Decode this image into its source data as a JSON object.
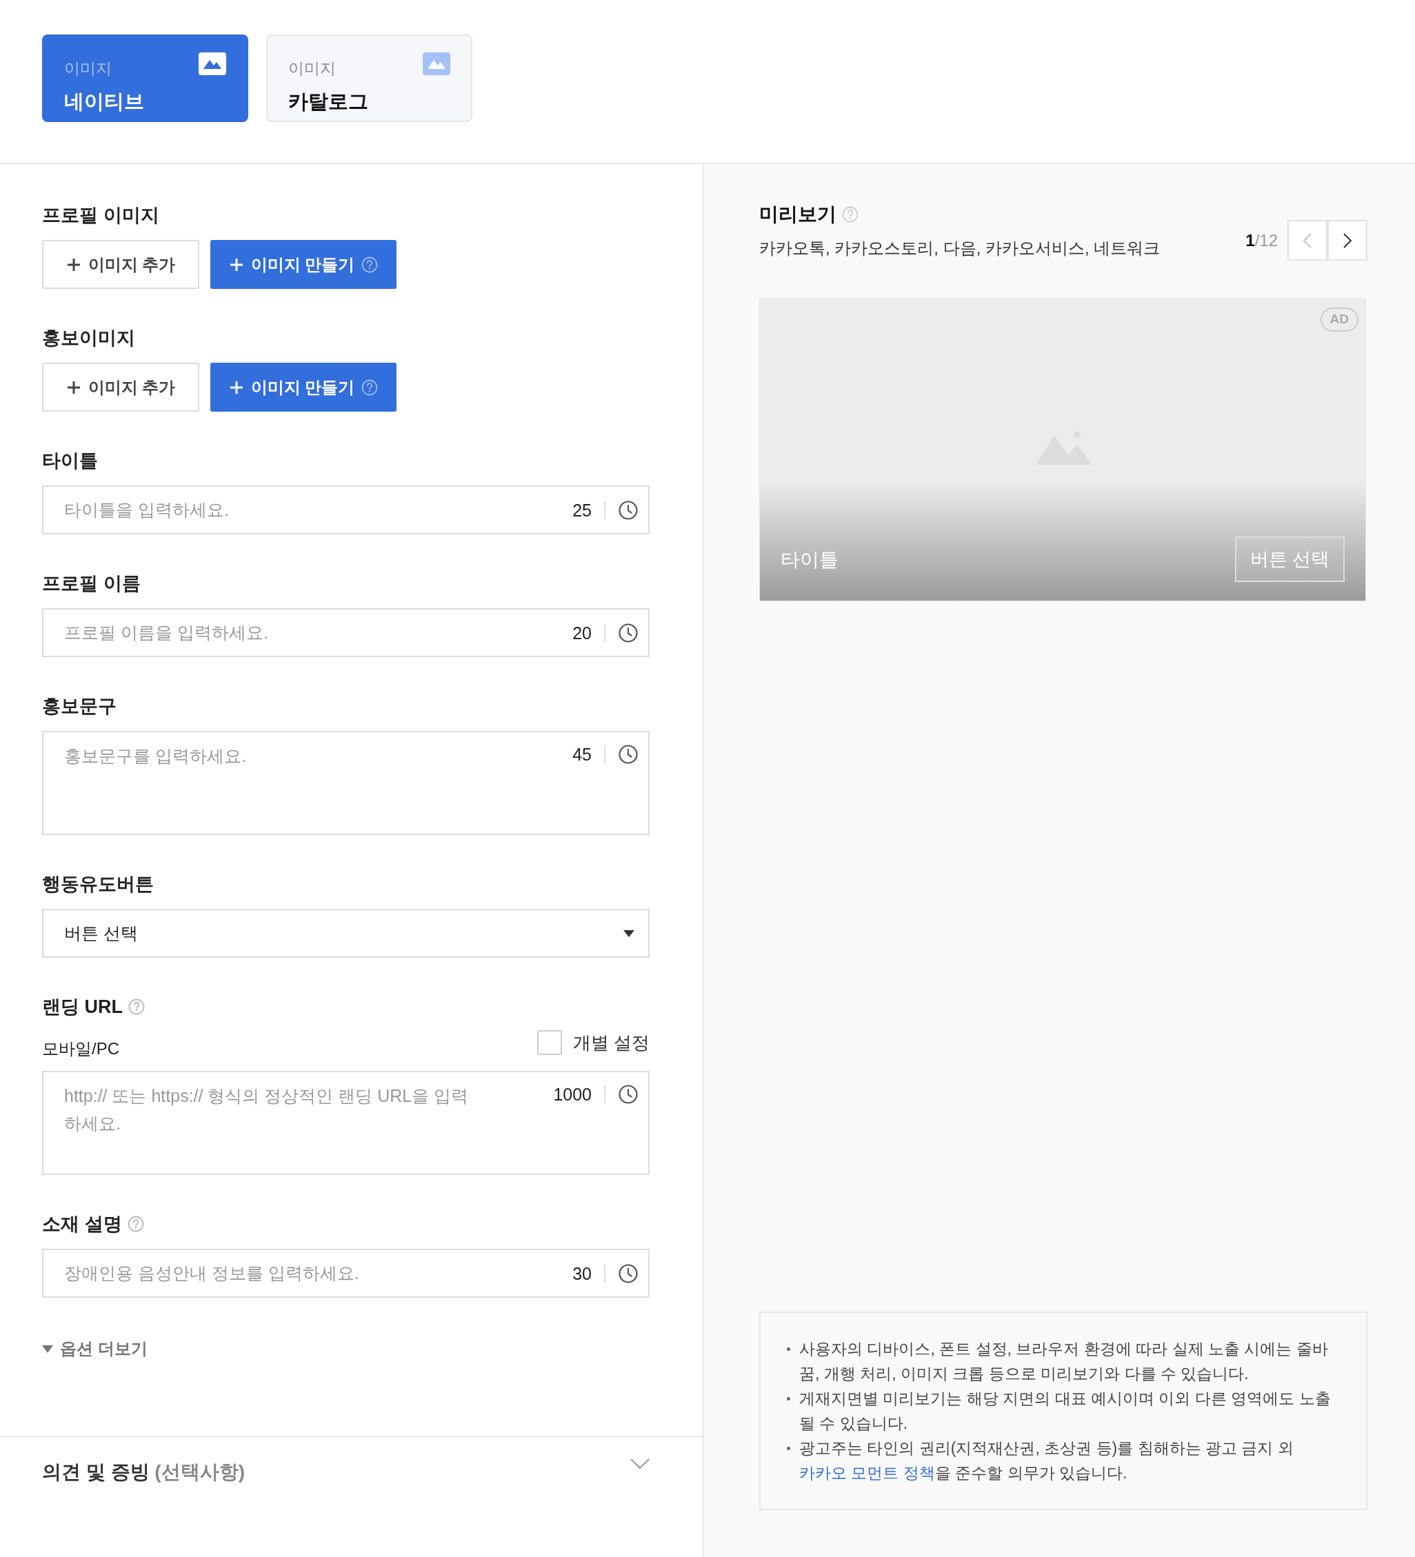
{
  "tabs": [
    {
      "caption": "이미지",
      "label": "네이티브",
      "selected": true
    },
    {
      "caption": "이미지",
      "label": "카탈로그",
      "selected": false
    }
  ],
  "image_sections": [
    {
      "label": "프로필 이미지",
      "buttons": [
        {
          "kind": "outline",
          "label": "이미지 추가",
          "help": false
        },
        {
          "kind": "primary",
          "label": "이미지 만들기",
          "help": true
        }
      ]
    },
    {
      "label": "홍보이미지",
      "buttons": [
        {
          "kind": "outline",
          "label": "이미지 추가",
          "help": false
        },
        {
          "kind": "primary",
          "label": "이미지 만들기",
          "help": true
        }
      ]
    }
  ],
  "fields": [
    {
      "kind": "input",
      "label": "타이틀",
      "help": false,
      "placeholder": "타이틀을 입력하세요.",
      "counter": "25"
    },
    {
      "kind": "input",
      "label": "프로필 이름",
      "help": false,
      "placeholder": "프로필 이름을 입력하세요.",
      "counter": "20"
    },
    {
      "kind": "textarea",
      "label": "홍보문구",
      "help": false,
      "placeholder": "홍보문구를 입력하세요.",
      "counter": "45"
    },
    {
      "kind": "select",
      "label": "행동유도버튼",
      "help": false,
      "value": "버튼 선택"
    },
    {
      "kind": "url",
      "label": "랜딩 URL",
      "help": true,
      "sublabel": "모바일/PC",
      "checkbox": {
        "label": "개별 설정",
        "checked": false
      },
      "placeholder": "http:// 또는 https:// 형식의 정상적인 랜딩 URL을 입력하세요.",
      "counter": "1000"
    },
    {
      "kind": "input",
      "label": "소재 설명",
      "help": true,
      "placeholder": "장애인용 음성안내 정보를 입력하세요.",
      "counter": "30"
    }
  ],
  "more_options": {
    "label": "옵션 더보기",
    "expanded": false
  },
  "opinion_section": {
    "title": "의견 및 증빙",
    "optional": "(선택사항)",
    "expanded": false
  },
  "preview": {
    "title": "미리보기",
    "placements": "카카오톡, 카카오스토리, 다음, 카카오서비스, 네트워크",
    "page_current": "1",
    "page_total": "/12",
    "prev_disabled": true,
    "next_disabled": false,
    "card": {
      "badge": "AD",
      "title": "타이틀",
      "button": "버튼 선택"
    }
  },
  "notes": [
    {
      "text": "사용자의 디바이스, 폰트 설정, 브라우저 환경에 따라 실제 노출 시에는 줄바꿈, 개행 처리, 이미지 크롭 등으로 미리보기와 다를 수 있습니다."
    },
    {
      "text": "게재지면별 미리보기는 해당 지면의 대표 예시이며 이외 다른 영역에도 노출될 수 있습니다."
    },
    {
      "text": "광고주는 타인의 권리(지적재산권, 초상권 등)를 침해하는 광고 금지 외 ",
      "link": "카카오 모먼트 정책",
      "after": "을 준수할 의무가 있습니다."
    }
  ]
}
